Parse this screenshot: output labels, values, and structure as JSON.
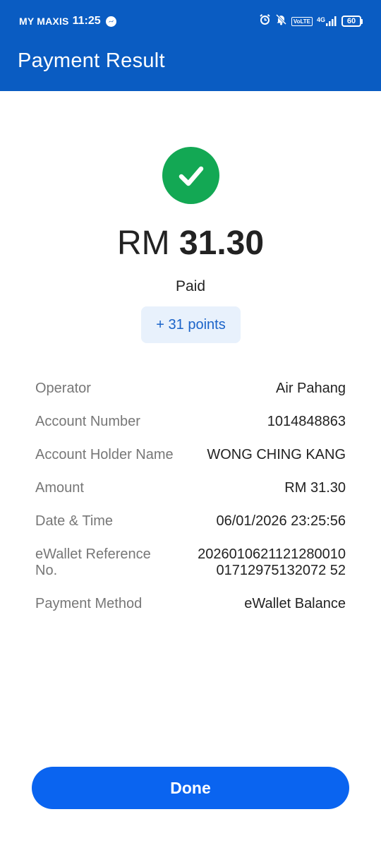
{
  "status_bar": {
    "carrier": "MY MAXIS",
    "time": "11:25",
    "volte": "VoLTE",
    "network": "4G",
    "battery": "60"
  },
  "header": {
    "title": "Payment Result"
  },
  "result": {
    "currency": "RM",
    "amount": "31.30",
    "status": "Paid",
    "points": "+ 31 points"
  },
  "details": [
    {
      "label": "Operator",
      "value": "Air Pahang"
    },
    {
      "label": "Account Number",
      "value": "1014848863"
    },
    {
      "label": "Account Holder Name",
      "value": "WONG CHING KANG"
    },
    {
      "label": "Amount",
      "value": "RM 31.30"
    },
    {
      "label": "Date & Time",
      "value": "06/01/2026 23:25:56"
    },
    {
      "label": "eWallet Reference No.",
      "value": "202601062112128001001712975132072 52"
    },
    {
      "label": "Payment Method",
      "value": "eWallet Balance"
    }
  ],
  "actions": {
    "done_label": "Done"
  },
  "colors": {
    "brand": "#0a5cc2",
    "success": "#13a854",
    "button": "#0a64f0"
  }
}
